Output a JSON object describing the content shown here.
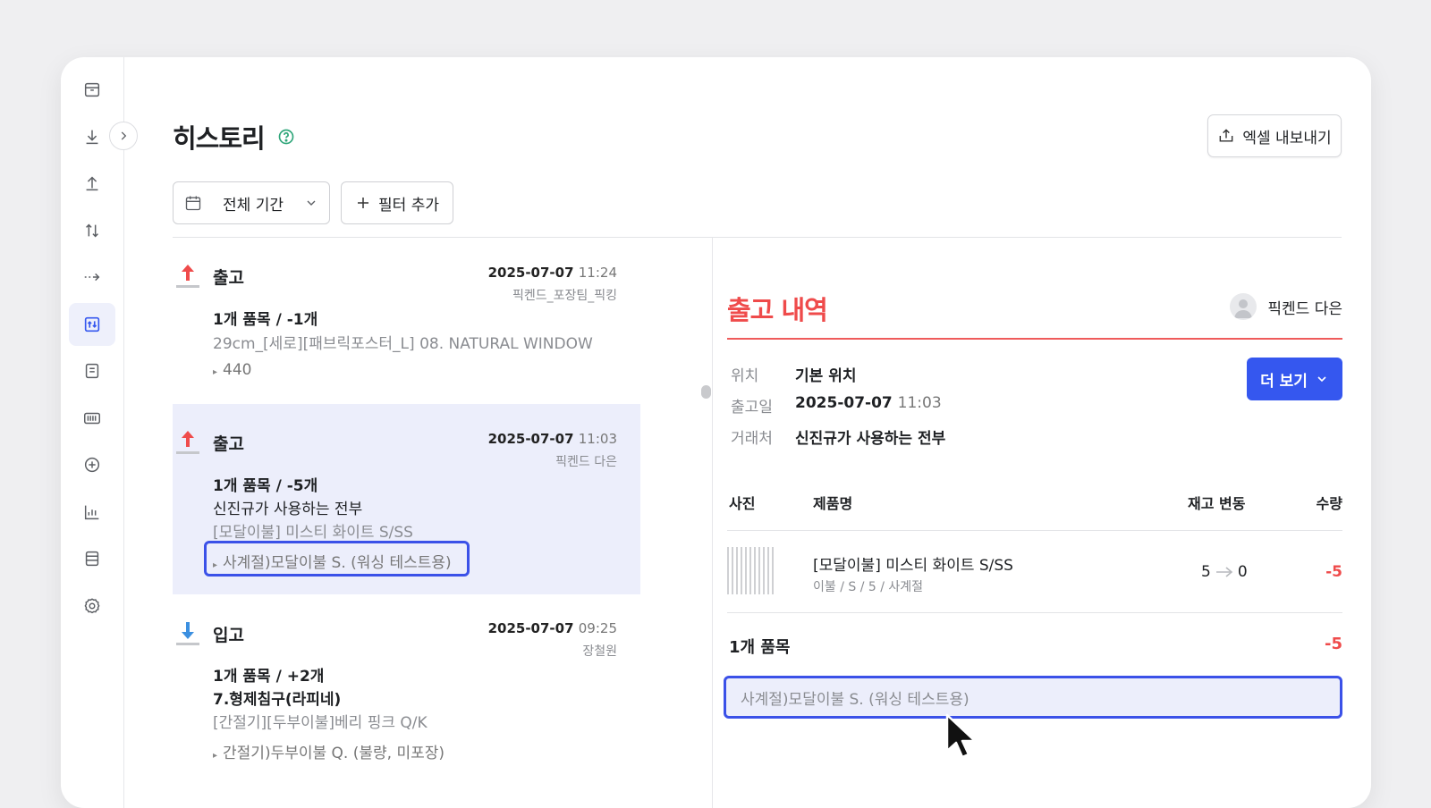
{
  "sidebar": {
    "items": [
      {
        "icon": "box-icon"
      },
      {
        "icon": "download-icon"
      },
      {
        "icon": "upload-icon"
      },
      {
        "icon": "transfer-icon"
      },
      {
        "icon": "move-arrow-icon"
      },
      {
        "icon": "history-icon",
        "active": true
      },
      {
        "icon": "document-icon"
      },
      {
        "icon": "barcode-icon"
      },
      {
        "icon": "plus-circle-icon"
      },
      {
        "icon": "bar-chart-icon"
      },
      {
        "icon": "database-icon"
      },
      {
        "icon": "gear-icon"
      }
    ]
  },
  "header": {
    "title": "히스토리",
    "export_label": "엑셀 내보내기"
  },
  "filters": {
    "period_label": "전체 기간",
    "add_filter_label": "필터 추가"
  },
  "entries": [
    {
      "type": "출고",
      "date": "2025-07-07",
      "time": "11:24",
      "user": "픽켄드_포장팀_픽킹",
      "summary": "1개 품목 / -1개",
      "product": "29cm_[세로][패브릭포스터_L] 08. NATURAL WINDOW",
      "option": "440"
    },
    {
      "type": "출고",
      "date": "2025-07-07",
      "time": "11:03",
      "user": "픽켄드 다은",
      "summary": "1개 품목 / -5개",
      "partner": "신진규가 사용하는 전부",
      "product": "[모달이불] 미스티 화이트 S/SS",
      "option": "사계절)모달이불 S. (워싱 테스트용)"
    },
    {
      "type": "입고",
      "date": "2025-07-07",
      "time": "09:25",
      "user": "장철원",
      "summary": "1개 품목 / +2개",
      "partner": "7.형제침구(라피네)",
      "product": "[간절기][두부이불]베리 핑크 Q/K",
      "option": "간절기)두부이불 Q. (불량, 미포장)"
    }
  ],
  "detail": {
    "title": "출고 내역",
    "user": "픽켄드 다은",
    "location_label": "위치",
    "location": "기본 위치",
    "date_label": "출고일",
    "date": "2025-07-07",
    "time": "11:03",
    "partner_label": "거래처",
    "partner": "신진규가 사용하는 전부",
    "more_label": "더 보기",
    "columns": {
      "photo": "사진",
      "name": "제품명",
      "change": "재고 변동",
      "qty": "수량"
    },
    "item": {
      "name": "[모달이불] 미스티 화이트 S/SS",
      "sub": "이불 / S / 5 / 사계절",
      "from": "5",
      "to": "0",
      "qty": "-5"
    },
    "summary_label": "1개 품목",
    "summary_qty": "-5",
    "memo": "사계절)모달이불 S. (워싱 테스트용)"
  },
  "colors": {
    "accent": "#3557ef",
    "outbound": "#ef4b4b",
    "inbound": "#3b8fe0",
    "highlight": "#3b51e8"
  }
}
